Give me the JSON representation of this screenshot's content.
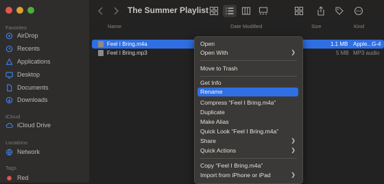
{
  "window": {
    "title": "The Summer Playlist"
  },
  "sidebar": {
    "favorites_label": "Favorites",
    "favorites": [
      {
        "label": "AirDrop",
        "icon": "airdrop-icon"
      },
      {
        "label": "Recents",
        "icon": "clock-icon"
      },
      {
        "label": "Applications",
        "icon": "applications-icon"
      },
      {
        "label": "Desktop",
        "icon": "desktop-icon"
      },
      {
        "label": "Documents",
        "icon": "document-icon"
      },
      {
        "label": "Downloads",
        "icon": "download-icon"
      }
    ],
    "icloud_label": "iCloud",
    "icloud": [
      {
        "label": "iCloud Drive",
        "icon": "cloud-icon"
      }
    ],
    "locations_label": "Locations",
    "locations": [
      {
        "label": "Network",
        "icon": "globe-icon"
      }
    ],
    "tags_label": "Tags",
    "tags": [
      {
        "label": "Red",
        "color": "#e2574c"
      }
    ]
  },
  "columns": {
    "name": "Name",
    "date": "Date Modified",
    "size": "Size",
    "kind": "Kind"
  },
  "files": [
    {
      "name": "Feel I Bring.m4a",
      "size": "1.1 MB",
      "kind": "Apple...G-4",
      "selected": true
    },
    {
      "name": "Feel I Bring.mp3",
      "size": "5 MB",
      "kind": "MP3 audio",
      "selected": false
    }
  ],
  "context_menu": {
    "open": "Open",
    "open_with": "Open With",
    "move_to_trash": "Move to Trash",
    "get_info": "Get Info",
    "rename": "Rename",
    "compress": "Compress “Feel I Bring.m4a”",
    "duplicate": "Duplicate",
    "make_alias": "Make Alias",
    "quick_look": "Quick Look “Feel I Bring.m4a”",
    "share": "Share",
    "quick_actions": "Quick Actions",
    "copy": "Copy “Feel I Bring.m4a”",
    "import_from_iphone": "Import from iPhone or iPad",
    "highlighted": "Rename",
    "submenu_arrow": "❯"
  },
  "colors": {
    "accent": "#2f6fe3",
    "menu_bg": "#3b3937",
    "sidebar_bg": "#2f2d2c"
  }
}
